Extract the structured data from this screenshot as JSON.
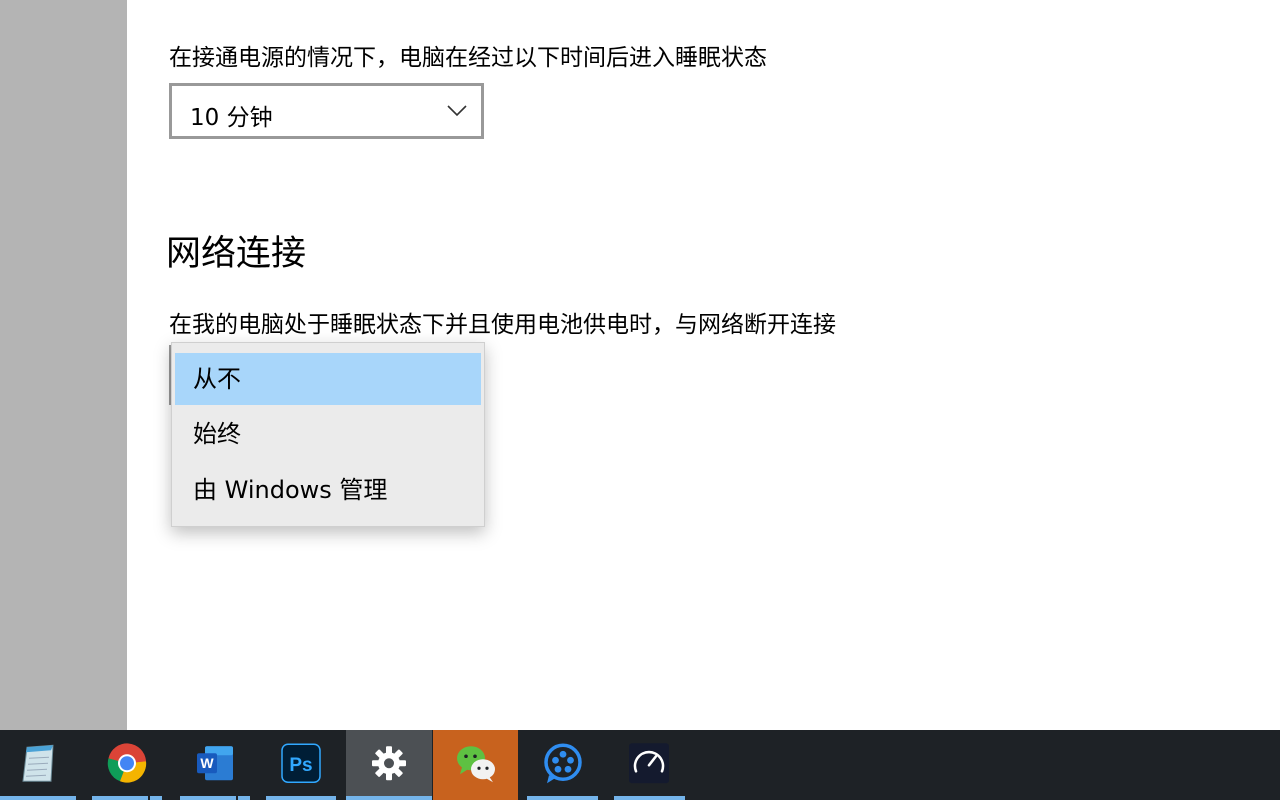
{
  "sleep": {
    "label": "在接通电源的情况下，电脑在经过以下时间后进入睡眠状态",
    "selected_value": "10 分钟"
  },
  "network": {
    "title": "网络连接",
    "label": "在我的电脑处于睡眠状态下并且使用电池供电时，与网络断开连接",
    "options": [
      "从不",
      "始终",
      "由 Windows 管理"
    ],
    "highlighted_option": "从不"
  },
  "taskbar": {
    "apps": [
      {
        "name": "notepad-icon"
      },
      {
        "name": "chrome-icon"
      },
      {
        "name": "word-icon"
      },
      {
        "name": "photoshop-icon",
        "text": "Ps"
      },
      {
        "name": "settings-gear-icon"
      },
      {
        "name": "wechat-icon"
      },
      {
        "name": "video-editor-icon"
      },
      {
        "name": "speedometer-icon"
      }
    ]
  },
  "colors": {
    "highlight": "#a8d6fa",
    "taskbar_bg": "#1e2226",
    "taskbar_underline": "#74b4ea",
    "wechat_active": "#c8621e",
    "settings_active": "#4c5054"
  }
}
